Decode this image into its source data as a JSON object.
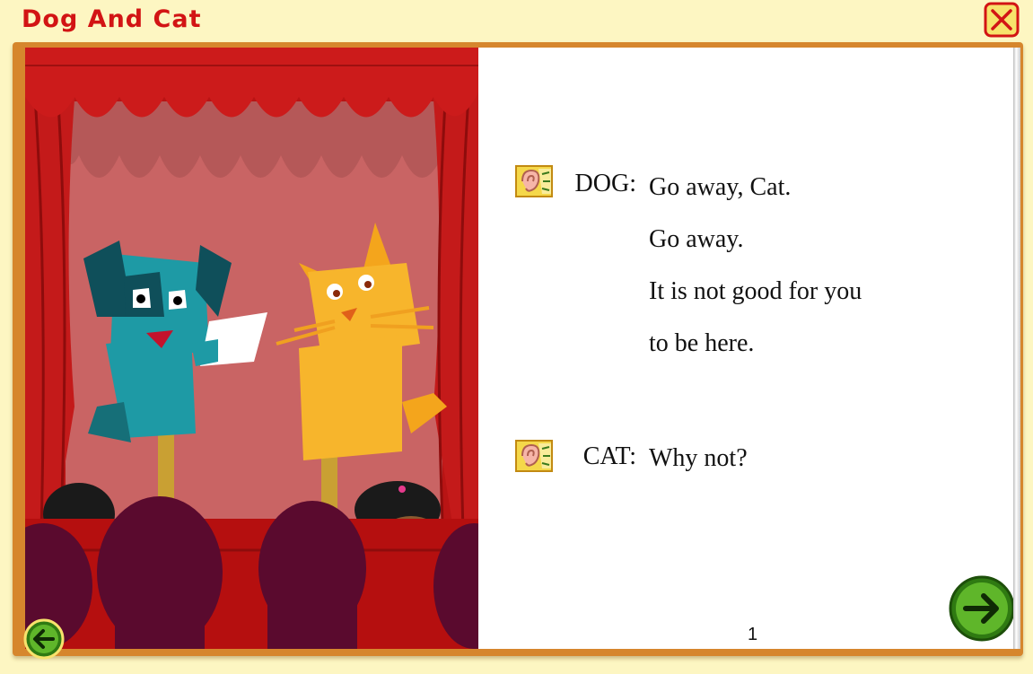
{
  "window": {
    "title": "Dog And Cat",
    "close_icon": "close-icon"
  },
  "page": {
    "number": "1",
    "dialogue": [
      {
        "speaker": "DOG:",
        "lines": [
          "Go away, Cat.",
          "Go away.",
          "It is not good for you",
          "to be here."
        ]
      },
      {
        "speaker": "CAT:",
        "lines": [
          "Why not?"
        ]
      }
    ]
  },
  "nav": {
    "prev_icon": "arrow-left-icon",
    "next_icon": "arrow-right-icon"
  },
  "colors": {
    "title": "#d21414",
    "frame": "#d6862d",
    "background": "#fdf6c2",
    "curtain": "#c51515",
    "nav_button": "#4a9a1c"
  }
}
